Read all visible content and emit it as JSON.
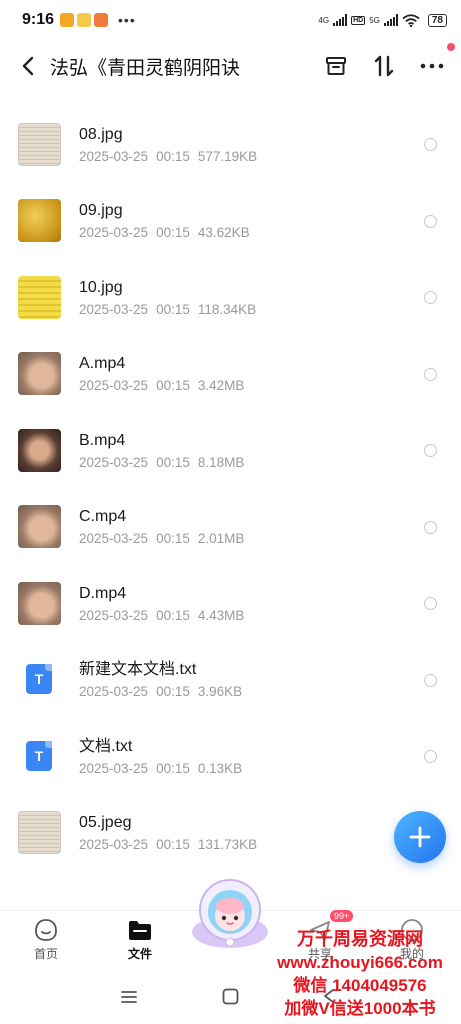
{
  "status": {
    "time": "9:16",
    "net1": "4G",
    "hd": "HD",
    "net2": "5G",
    "battery": "78"
  },
  "header": {
    "title": "法弘《青田灵鹤阴阳诀"
  },
  "files": [
    {
      "name": "08.jpg",
      "date": "2025-03-25",
      "time": "00:15",
      "size": "577.19KB",
      "thumb": "doc-scan"
    },
    {
      "name": "09.jpg",
      "date": "2025-03-25",
      "time": "00:15",
      "size": "43.62KB",
      "thumb": "gold"
    },
    {
      "name": "10.jpg",
      "date": "2025-03-25",
      "time": "00:15",
      "size": "118.34KB",
      "thumb": "yellow-doc"
    },
    {
      "name": "A.mp4",
      "date": "2025-03-25",
      "time": "00:15",
      "size": "3.42MB",
      "thumb": "hand"
    },
    {
      "name": "B.mp4",
      "date": "2025-03-25",
      "time": "00:15",
      "size": "8.18MB",
      "thumb": "hand-dark"
    },
    {
      "name": "C.mp4",
      "date": "2025-03-25",
      "time": "00:15",
      "size": "2.01MB",
      "thumb": "hand"
    },
    {
      "name": "D.mp4",
      "date": "2025-03-25",
      "time": "00:15",
      "size": "4.43MB",
      "thumb": "hand"
    },
    {
      "name": "新建文本文档.txt",
      "date": "2025-03-25",
      "time": "00:15",
      "size": "3.96KB",
      "thumb": "txt"
    },
    {
      "name": "文档.txt",
      "date": "2025-03-25",
      "time": "00:15",
      "size": "0.13KB",
      "thumb": "txt"
    },
    {
      "name": "05.jpeg",
      "date": "2025-03-25",
      "time": "00:15",
      "size": "131.73KB",
      "thumb": "doc-scan"
    }
  ],
  "txt_icon_letter": "T",
  "tabs": [
    {
      "label": "首页",
      "icon": "home-face-icon",
      "active": false
    },
    {
      "label": "文件",
      "icon": "folder-icon",
      "active": true
    },
    {
      "label": "共享",
      "icon": "share-icon",
      "active": false
    },
    {
      "label": "我的",
      "icon": "profile-icon",
      "active": false
    }
  ],
  "share_badge": "99+",
  "watermark": {
    "line1": "万千周易资源网",
    "line2": "www.zhouyi666.com",
    "line3": "微信 1404049576",
    "line4": "加微V信送1000本书"
  },
  "colors": {
    "accent": "#2f80ed",
    "badge": "#ff4d6a",
    "watermark": "#e8141e",
    "meta_text": "#9a9a9a"
  }
}
